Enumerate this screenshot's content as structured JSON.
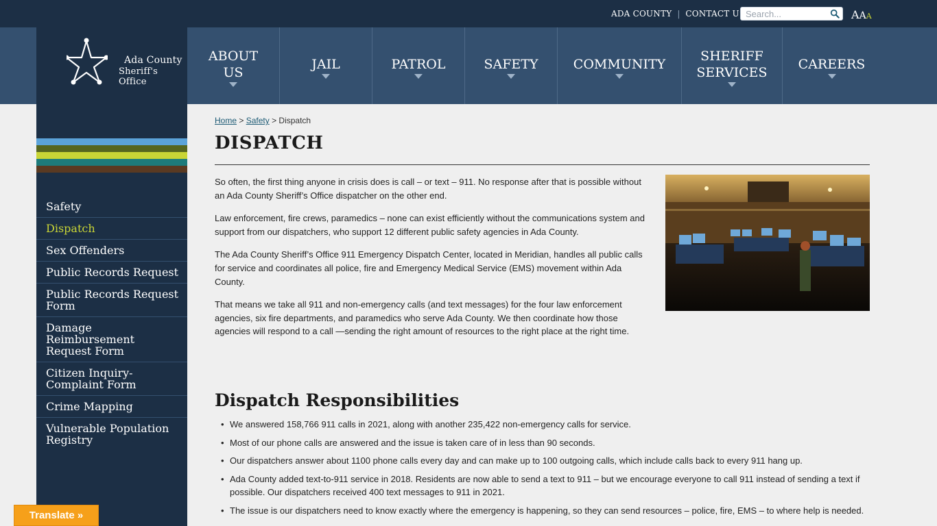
{
  "topbar": {
    "links": [
      "ADA COUNTY",
      "CONTACT US"
    ],
    "search_placeholder": "Search...",
    "font_sizes": [
      "A",
      "A",
      "A"
    ]
  },
  "logo": {
    "line1": "Ada County",
    "line2": "Sheriff's Office"
  },
  "nav": {
    "items": [
      {
        "label": "ABOUT US"
      },
      {
        "label": "JAIL"
      },
      {
        "label": "PATROL"
      },
      {
        "label": "SAFETY"
      },
      {
        "label": "COMMUNITY"
      },
      {
        "label": "SHERIFF SERVICES"
      },
      {
        "label": "CAREERS"
      }
    ]
  },
  "sidebar": {
    "stripe_colors": [
      "#5ba3d9",
      "#56661f",
      "#c9d536",
      "#1d7b7b",
      "#5a3a22"
    ],
    "items": [
      {
        "label": "Safety",
        "active": false
      },
      {
        "label": "Dispatch",
        "active": true
      },
      {
        "label": "Sex Offenders",
        "active": false
      },
      {
        "label": "Public Records Request",
        "active": false
      },
      {
        "label": "Public Records Request Form",
        "active": false
      },
      {
        "label": "Damage Reimbursement Request Form",
        "active": false
      },
      {
        "label": "Citizen Inquiry-Complaint Form",
        "active": false
      },
      {
        "label": "Crime Mapping",
        "active": false
      },
      {
        "label": "Vulnerable Population Registry",
        "active": false
      }
    ]
  },
  "breadcrumb": {
    "home": "Home",
    "sep1": " > ",
    "section": "Safety",
    "sep2": " > ",
    "current": "Dispatch"
  },
  "page": {
    "title": "DISPATCH",
    "paragraphs": [
      "So often, the first thing anyone in crisis does is call – or text – 911. No response after that is possible without an Ada County Sheriff’s Office dispatcher on the other end.",
      "Law enforcement, fire crews, paramedics – none can exist efficiently without the communications system and support from our dispatchers, who support 12 different public safety agencies in Ada County.",
      "The Ada County Sheriff’s Office 911 Emergency Dispatch Center, located in Meridian, handles all public calls for service and coordinates all police, fire and Emergency Medical Service (EMS) movement within Ada County.",
      "That means we take all 911 and non-emergency calls (and text messages) for the four law enforcement agencies, six fire departments, and paramedics who serve Ada County. We then coordinate how those agencies will respond to a call —sending the right amount of resources to the right place at the right time."
    ],
    "section_heading": "Dispatch Responsibilities",
    "bullets": [
      "We answered 158,766 911 calls in 2021, along with another 235,422 non-emergency calls for service.",
      "Most of our phone calls are answered and the issue is taken care of in less than 90 seconds.",
      "Our dispatchers answer about 1100 phone calls every day and can make up to 100 outgoing calls, which include calls back to every 911 hang up.",
      "Ada County added text-to-911 service in 2018. Residents are now able to send a text to 911 – but we encourage everyone to call 911 instead of sending a text if possible. Our dispatchers received 400 text messages to 911 in 2021.",
      "The issue is our dispatchers need to know exactly where the emergency is happening, so they can send resources – police, fire, EMS – to where help is needed."
    ]
  },
  "translate": {
    "label": "Translate »"
  }
}
